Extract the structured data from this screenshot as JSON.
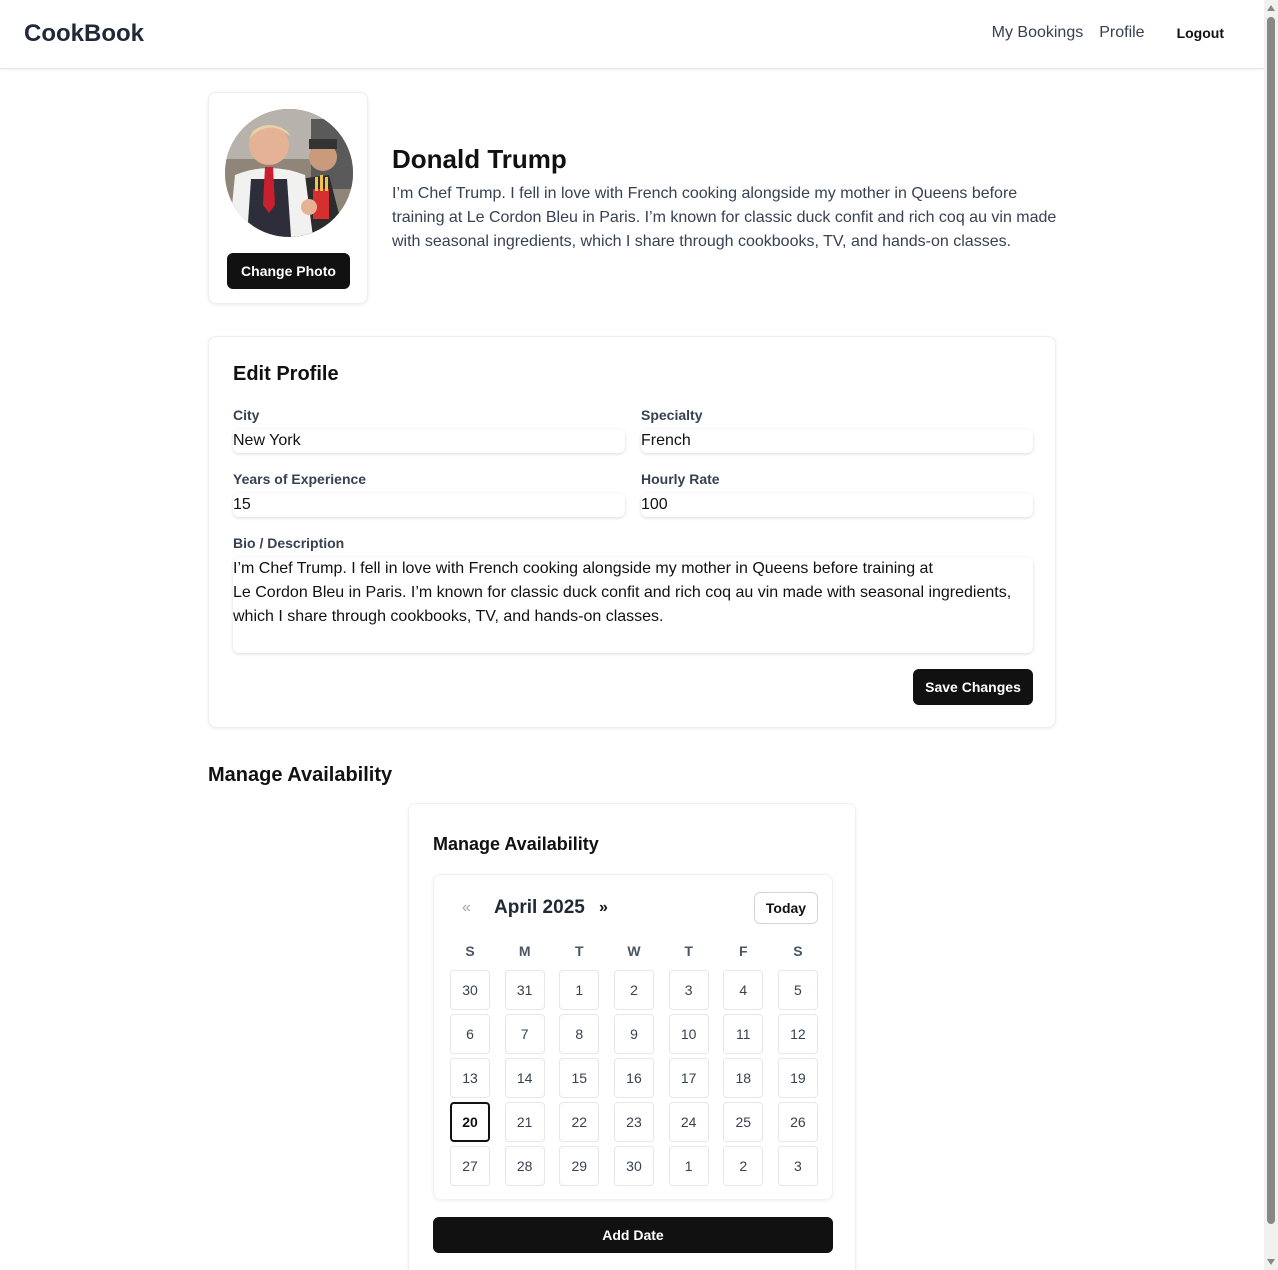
{
  "nav": {
    "brand": "CookBook",
    "links": [
      "My Bookings",
      "Profile"
    ],
    "logout": "Logout"
  },
  "profile": {
    "name": "Donald Trump",
    "bio": "I’m Chef Trump. I fell in love with French cooking alongside my mother in Queens before training at Le Cordon Bleu in Paris. I’m known for classic duck confit and rich coq au vin made with seasonal ingredients, which I share through cookbooks, TV, and hands-on classes.",
    "change_photo": "Change Photo"
  },
  "edit": {
    "title": "Edit Profile",
    "city_label": "City",
    "city": "New York",
    "specialty_label": "Specialty",
    "specialty": "French",
    "experience_label": "Years of Experience",
    "experience": "15",
    "rate_label": "Hourly Rate",
    "rate": "100",
    "bio_label": "Bio / Description",
    "bio": "I’m Chef Trump. I fell in love with French cooking alongside my mother in Queens before training at\nLe Cordon Bleu in Paris. I’m known for classic duck confit and rich coq au vin made with seasonal ingredients,\nwhich I share through cookbooks, TV, and hands-on classes.",
    "save": "Save Changes"
  },
  "availability": {
    "section_title": "Manage Availability",
    "card_title": "Manage Availability",
    "prev": "«",
    "next": "»",
    "month": "April 2025",
    "today_label": "Today",
    "weekdays": [
      "S",
      "M",
      "T",
      "W",
      "T",
      "F",
      "S"
    ],
    "days": [
      "30",
      "31",
      "1",
      "2",
      "3",
      "4",
      "5",
      "6",
      "7",
      "8",
      "9",
      "10",
      "11",
      "12",
      "13",
      "14",
      "15",
      "16",
      "17",
      "18",
      "19",
      "20",
      "21",
      "22",
      "23",
      "24",
      "25",
      "26",
      "27",
      "28",
      "29",
      "30",
      "1",
      "2",
      "3"
    ],
    "today_day": "20",
    "add_date": "Add Date"
  }
}
